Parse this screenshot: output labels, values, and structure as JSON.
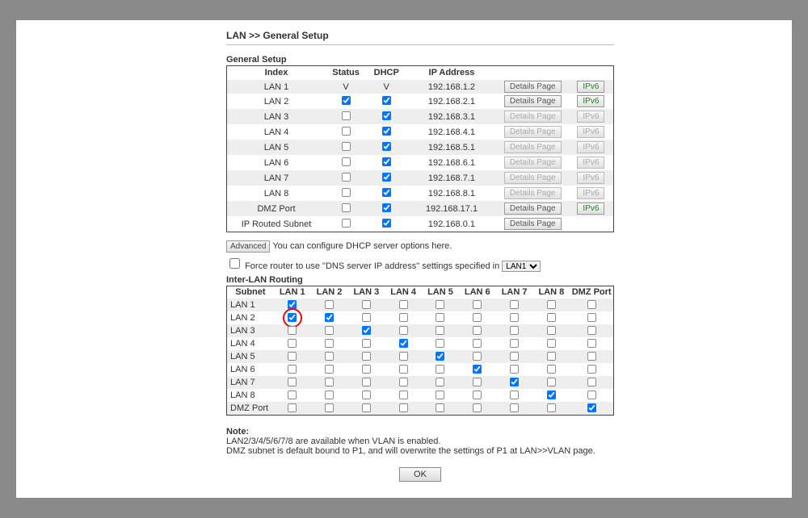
{
  "breadcrumb": "LAN >> General Setup",
  "general_setup_title": "General Setup",
  "headers": {
    "index": "Index",
    "status": "Status",
    "dhcp": "DHCP",
    "ip": "IP Address"
  },
  "btn_details": "Details Page",
  "btn_ipv6": "IPv6",
  "rows": [
    {
      "index": "LAN 1",
      "status_text": "V",
      "dhcp_text": "V",
      "status_cb": null,
      "dhcp_cb": null,
      "ip": "192.168.1.2",
      "details_enabled": true,
      "ipv6_enabled": true
    },
    {
      "index": "LAN 2",
      "status_cb": true,
      "dhcp_cb": true,
      "ip": "192.168.2.1",
      "details_enabled": true,
      "ipv6_enabled": true
    },
    {
      "index": "LAN 3",
      "status_cb": false,
      "dhcp_cb": true,
      "ip": "192.168.3.1",
      "details_enabled": false,
      "ipv6_enabled": false
    },
    {
      "index": "LAN 4",
      "status_cb": false,
      "dhcp_cb": true,
      "ip": "192.168.4.1",
      "details_enabled": false,
      "ipv6_enabled": false
    },
    {
      "index": "LAN 5",
      "status_cb": false,
      "dhcp_cb": true,
      "ip": "192.168.5.1",
      "details_enabled": false,
      "ipv6_enabled": false
    },
    {
      "index": "LAN 6",
      "status_cb": false,
      "dhcp_cb": true,
      "ip": "192.168.6.1",
      "details_enabled": false,
      "ipv6_enabled": false
    },
    {
      "index": "LAN 7",
      "status_cb": false,
      "dhcp_cb": true,
      "ip": "192.168.7.1",
      "details_enabled": false,
      "ipv6_enabled": false
    },
    {
      "index": "LAN 8",
      "status_cb": false,
      "dhcp_cb": true,
      "ip": "192.168.8.1",
      "details_enabled": false,
      "ipv6_enabled": false
    },
    {
      "index": "DMZ Port",
      "status_cb": false,
      "dhcp_cb": true,
      "ip": "192.168.17.1",
      "details_enabled": true,
      "ipv6_enabled": true
    },
    {
      "index": "IP Routed Subnet",
      "status_cb": false,
      "dhcp_cb": true,
      "ip": "192.168.0.1",
      "details_enabled": true,
      "ipv6_enabled": null
    }
  ],
  "advanced_btn": "Advanced",
  "advanced_text": "You can configure DHCP server options here.",
  "force_text": "Force router to use \"DNS server IP address\" settings specified in",
  "force_checked": false,
  "force_selected": "LAN1",
  "force_options": [
    "LAN1"
  ],
  "interlan_title": "Inter-LAN Routing",
  "routing_headers": [
    "Subnet",
    "LAN 1",
    "LAN 2",
    "LAN 3",
    "LAN 4",
    "LAN 5",
    "LAN 6",
    "LAN 7",
    "LAN 8",
    "DMZ Port"
  ],
  "routing_rows": [
    {
      "name": "LAN 1",
      "cells": [
        true,
        false,
        false,
        false,
        false,
        false,
        false,
        false,
        false
      ],
      "highlight_col": null
    },
    {
      "name": "LAN 2",
      "cells": [
        true,
        true,
        false,
        false,
        false,
        false,
        false,
        false,
        false
      ],
      "highlight_col": 0
    },
    {
      "name": "LAN 3",
      "cells": [
        false,
        false,
        true,
        false,
        false,
        false,
        false,
        false,
        false
      ],
      "highlight_col": null
    },
    {
      "name": "LAN 4",
      "cells": [
        false,
        false,
        false,
        true,
        false,
        false,
        false,
        false,
        false
      ],
      "highlight_col": null
    },
    {
      "name": "LAN 5",
      "cells": [
        false,
        false,
        false,
        false,
        true,
        false,
        false,
        false,
        false
      ],
      "highlight_col": null
    },
    {
      "name": "LAN 6",
      "cells": [
        false,
        false,
        false,
        false,
        false,
        true,
        false,
        false,
        false
      ],
      "highlight_col": null
    },
    {
      "name": "LAN 7",
      "cells": [
        false,
        false,
        false,
        false,
        false,
        false,
        true,
        false,
        false
      ],
      "highlight_col": null
    },
    {
      "name": "LAN 8",
      "cells": [
        false,
        false,
        false,
        false,
        false,
        false,
        false,
        true,
        false
      ],
      "highlight_col": null
    },
    {
      "name": "DMZ Port",
      "cells": [
        false,
        false,
        false,
        false,
        false,
        false,
        false,
        false,
        true
      ],
      "highlight_col": null
    }
  ],
  "note_header": "Note:",
  "note_line1": "LAN2/3/4/5/6/7/8 are available when VLAN is enabled.",
  "note_line2": "DMZ subnet is default bound to P1, and will overwrite the settings of P1 at LAN>>VLAN page.",
  "ok_btn": "OK"
}
